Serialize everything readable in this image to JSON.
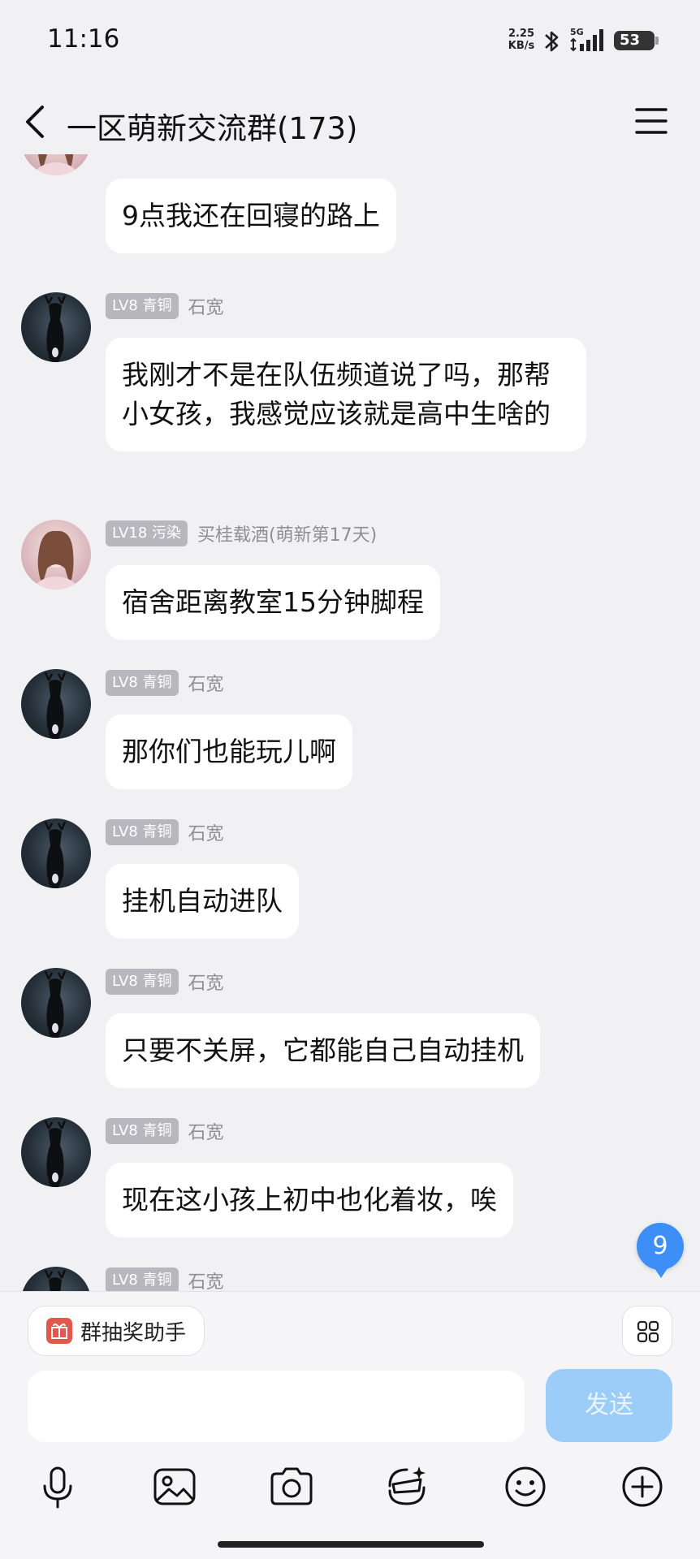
{
  "status_bar": {
    "time": "11:16",
    "net_speed_value": "2.25",
    "net_speed_unit": "KB/s",
    "signal_label": "5G",
    "battery": "53"
  },
  "header": {
    "title": "一区萌新交流群(173)"
  },
  "messages": [
    {
      "level": "",
      "sender": "",
      "text": "9点我还在回寝的路上",
      "avatar": "girl-avatar"
    },
    {
      "level": "LV8 青铜",
      "sender": "石宽",
      "text": "我刚才不是在队伍频道说了吗，那帮小女孩，我感觉应该就是高中生啥的",
      "avatar": "deer-avatar"
    },
    {
      "level": "LV18 污染",
      "sender": "买桂载酒(萌新第17天)",
      "text": "宿舍距离教室15分钟脚程",
      "avatar": "girl-avatar"
    },
    {
      "level": "LV8 青铜",
      "sender": "石宽",
      "text": "那你们也能玩儿啊",
      "avatar": "deer-avatar"
    },
    {
      "level": "LV8 青铜",
      "sender": "石宽",
      "text": "挂机自动进队",
      "avatar": "deer-avatar"
    },
    {
      "level": "LV8 青铜",
      "sender": "石宽",
      "text": "只要不关屏，它都能自己自动挂机",
      "avatar": "deer-avatar"
    },
    {
      "level": "LV8 青铜",
      "sender": "石宽",
      "text": "现在这小孩上初中也化着妆，唉",
      "avatar": "deer-avatar"
    },
    {
      "level": "LV8 青铜",
      "sender": "石宽",
      "text": "",
      "avatar": "deer-avatar"
    }
  ],
  "unread_count": "9",
  "bottom": {
    "lottery_label": "群抽奖助手",
    "input_value": "",
    "send_label": "发送",
    "toolbar": [
      "microphone-icon",
      "image-icon",
      "camera-icon",
      "sticker-search-icon",
      "emoji-icon",
      "plus-icon"
    ]
  }
}
